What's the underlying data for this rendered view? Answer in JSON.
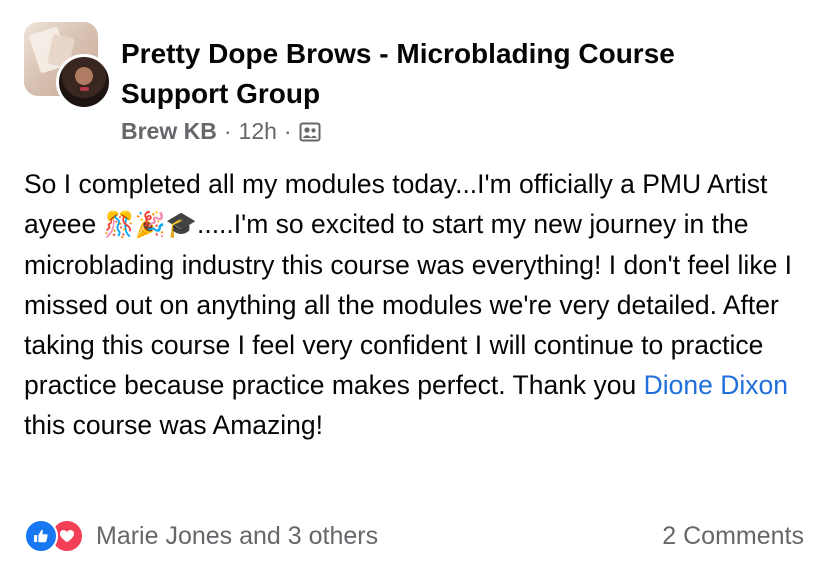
{
  "post": {
    "group_name": "Pretty Dope Brows - Microblading Course Support Group",
    "author": "Brew KB",
    "separator": "·",
    "time": "12h",
    "body_intro": "So I completed all my modules today...I'm officially a PMU Artist ayeee ",
    "emojis": "🎊🎉🎓",
    "body_main": ".....I'm so excited to start my new journey in the microblading industry this course was everything! I don't feel like I missed out on anything all the modules we're very detailed. After taking this course I feel very confident I will continue to practice practice because practice makes perfect.  Thank you ",
    "mention": "Dione Dixon",
    "body_end": " this course was Amazing!"
  },
  "footer": {
    "reactions": [
      "like",
      "love"
    ],
    "reactors": "Marie Jones and 3 others",
    "comments": "2 Comments"
  },
  "colors": {
    "text": "#050505",
    "secondary": "#65676b",
    "link": "#216fdb",
    "like": "#1877f2",
    "love": "#f33e58"
  },
  "icons": {
    "visibility": "group-members-icon",
    "like": "thumbs-up-icon",
    "love": "heart-icon"
  }
}
